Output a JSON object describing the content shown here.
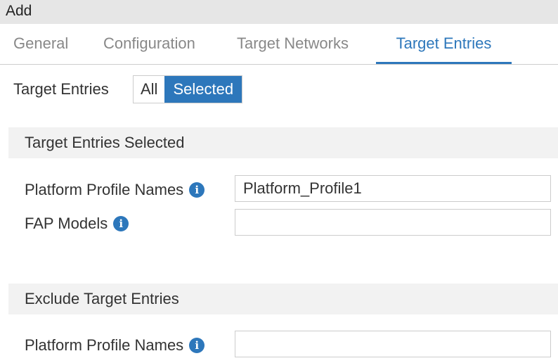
{
  "header": {
    "title": "Add"
  },
  "tabs": [
    {
      "label": "General"
    },
    {
      "label": "Configuration"
    },
    {
      "label": "Target Networks"
    },
    {
      "label": "Target Entries",
      "active": true
    }
  ],
  "target_entries": {
    "label": "Target Entries",
    "options": [
      "All",
      "Selected"
    ],
    "selected": "Selected"
  },
  "selected_section": {
    "title": "Target Entries Selected",
    "fields": [
      {
        "label": "Platform Profile Names",
        "value": "Platform_Profile1"
      },
      {
        "label": "FAP Models",
        "value": ""
      }
    ]
  },
  "exclude_section": {
    "title": "Exclude Target Entries",
    "fields": [
      {
        "label": "Platform Profile Names",
        "value": ""
      }
    ]
  },
  "icons": {
    "info": "info-circle-icon"
  },
  "colors": {
    "accent": "#2d77bb"
  }
}
